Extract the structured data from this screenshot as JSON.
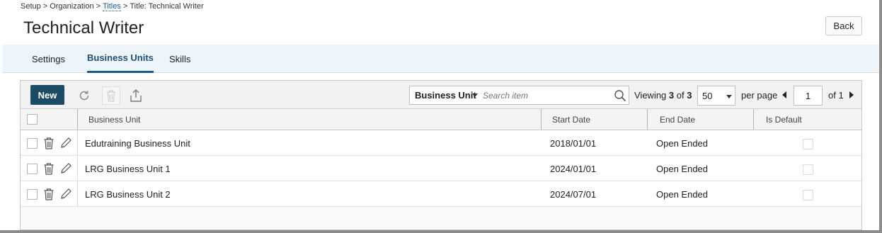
{
  "breadcrumb": {
    "items": [
      "Setup",
      "Organization",
      "Titles",
      "Title: Technical Writer"
    ],
    "separator": ">"
  },
  "page": {
    "title": "Technical Writer",
    "back_label": "Back"
  },
  "tabs": [
    {
      "label": "Settings",
      "active": false
    },
    {
      "label": "Business Units",
      "active": true
    },
    {
      "label": "Skills",
      "active": false
    }
  ],
  "toolbar": {
    "new_label": "New",
    "icons": [
      "refresh-icon",
      "delete-icon",
      "export-icon"
    ]
  },
  "search": {
    "field": "Business Unit",
    "placeholder": "Search item"
  },
  "paging": {
    "viewing_label": "Viewing",
    "viewing_count": "3",
    "of_label": "of",
    "viewing_total": "3",
    "per_page_value": "50",
    "per_page_label": "per page",
    "current_page": "1",
    "of_pages": "of 1"
  },
  "table": {
    "columns": [
      "Business Unit",
      "Start Date",
      "End Date",
      "Is Default"
    ],
    "rows": [
      {
        "business_unit": "Edutraining Business Unit",
        "start_date": "2018/01/01",
        "end_date": "Open Ended",
        "is_default": false
      },
      {
        "business_unit": "LRG Business Unit 1",
        "start_date": "2024/01/01",
        "end_date": "Open Ended",
        "is_default": false
      },
      {
        "business_unit": "LRG Business Unit 2",
        "start_date": "2024/07/01",
        "end_date": "Open Ended",
        "is_default": false
      }
    ]
  },
  "colors": {
    "accent": "#1c5c8a",
    "new_button": "#1b4c63",
    "tab_bar": "#eef5fa"
  }
}
